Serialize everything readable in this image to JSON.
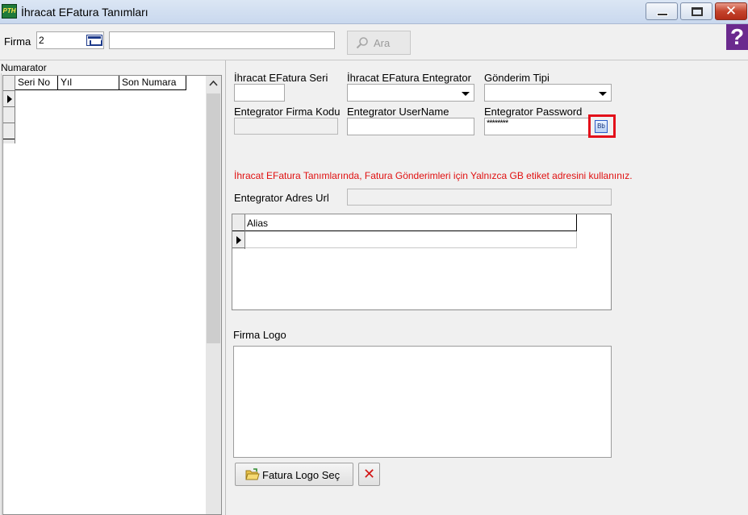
{
  "window": {
    "title": "İhracat EFatura Tanımları",
    "app_icon_text": "PTH",
    "minimize_glyph": "",
    "maximize_glyph": "",
    "close_glyph": "✕"
  },
  "toolbar": {
    "firma_label": "Firma",
    "firma_value": "2",
    "firma_name_value": "",
    "search_label": "Ara",
    "help_glyph": "?"
  },
  "numarator": {
    "panel_label": "Numarator",
    "columns": [
      "Seri No",
      "Yıl",
      "Son Numara"
    ],
    "rows": []
  },
  "form": {
    "seri_label": "İhracat EFatura Seri",
    "seri_value": "",
    "entegrator_label": "İhracat EFatura Entegrator",
    "entegrator_value": "",
    "gonderim_label": "Gönderim Tipi",
    "gonderim_value": "",
    "firma_kodu_label": "Entegrator Firma Kodu",
    "firma_kodu_value": "",
    "username_label": "Entegrator UserName",
    "username_value": "",
    "password_label": "Entegrator Password",
    "password_value": "********",
    "password_button_text": "Bb",
    "warning_text": "İhracat EFatura Tanımlarında, Fatura Gönderimleri için Yalnızca GB etiket adresini kullanınız.",
    "url_label": "Entegrator Adres Url",
    "url_value": ""
  },
  "alias_grid": {
    "columns": [
      "Alias"
    ],
    "rows": []
  },
  "logo": {
    "label": "Firma Logo",
    "select_button": "Fatura Logo Seç",
    "delete_glyph": "✕"
  },
  "colors": {
    "warning": "#e01010",
    "highlight": "#e3101a",
    "help_bg": "#6b2a8e"
  }
}
